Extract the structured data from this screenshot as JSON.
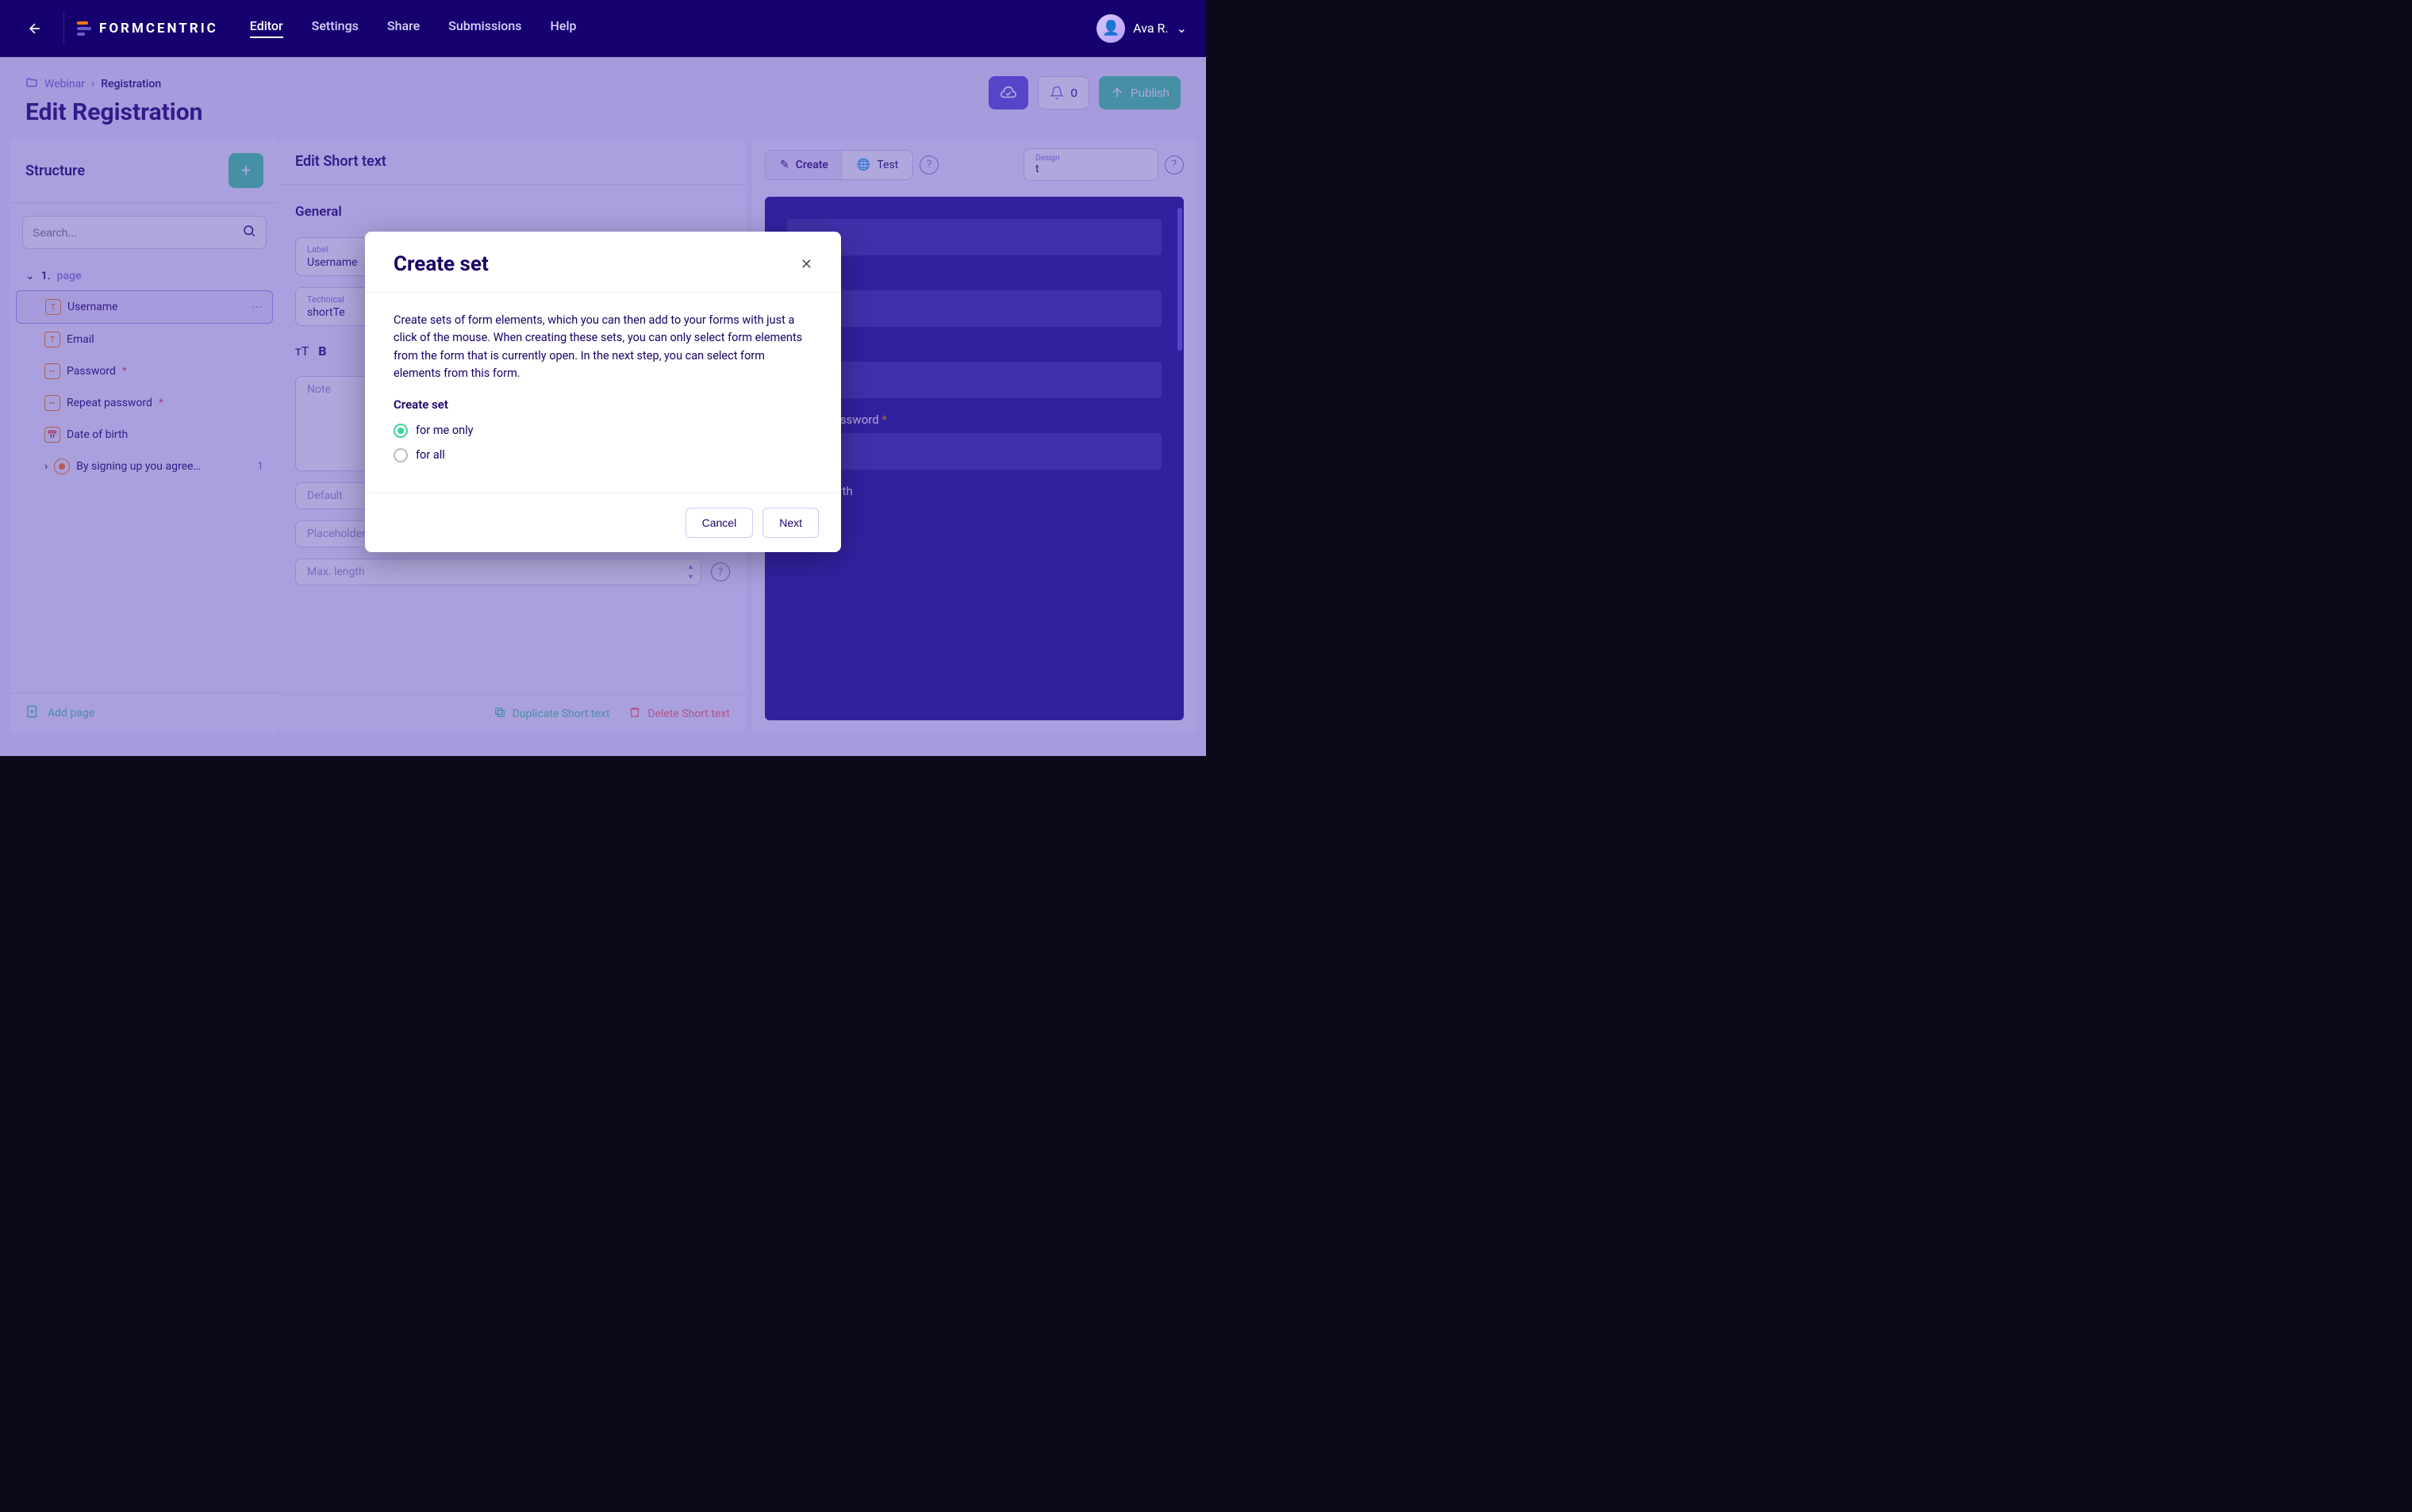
{
  "brand": "FORMCENTRIC",
  "nav": {
    "editor": "Editor",
    "settings": "Settings",
    "share": "Share",
    "submissions": "Submissions",
    "help": "Help"
  },
  "user": {
    "name": "Ava R."
  },
  "breadcrumb": {
    "parent": "Webinar",
    "current": "Registration"
  },
  "page_title": "Edit Registration",
  "header": {
    "notif_count": "0",
    "publish": "Publish"
  },
  "left": {
    "title": "Structure",
    "search_placeholder": "Search...",
    "page_prefix": "1.",
    "page_label": "page",
    "items": {
      "username": "Username",
      "email": "Email",
      "password": "Password",
      "repeat_password": "Repeat password",
      "dob": "Date of birth",
      "terms": "By signing up you agree to ter",
      "terms_badge": "1"
    },
    "add_page": "Add page"
  },
  "mid": {
    "title": "Edit Short text",
    "general": "General",
    "label_lbl": "Label",
    "label_val": "Username",
    "tech_lbl": "Technical",
    "tech_val": "shortTe",
    "note_lbl": "Note",
    "default_ph": "Default",
    "placeholder_ph": "Placeholder",
    "maxlen_ph": "Max. length",
    "dup": "Duplicate Short text",
    "del": "Delete Short text"
  },
  "right": {
    "create": "Create",
    "test": "Test",
    "design_lbl": "Design",
    "design_val": "t",
    "preview": {
      "repeat_password": "Repeat password",
      "dob": "Date of birth"
    }
  },
  "modal": {
    "title": "Create set",
    "body": "Create sets of form elements, which you can then add to your forms with just a click of the mouse. When creating these sets, you can only select form elements from the form that is currently open. In the next step, you can select form elements from this form.",
    "subhead": "Create set",
    "opt_me": "for me only",
    "opt_all": "for all",
    "cancel": "Cancel",
    "next": "Next"
  }
}
